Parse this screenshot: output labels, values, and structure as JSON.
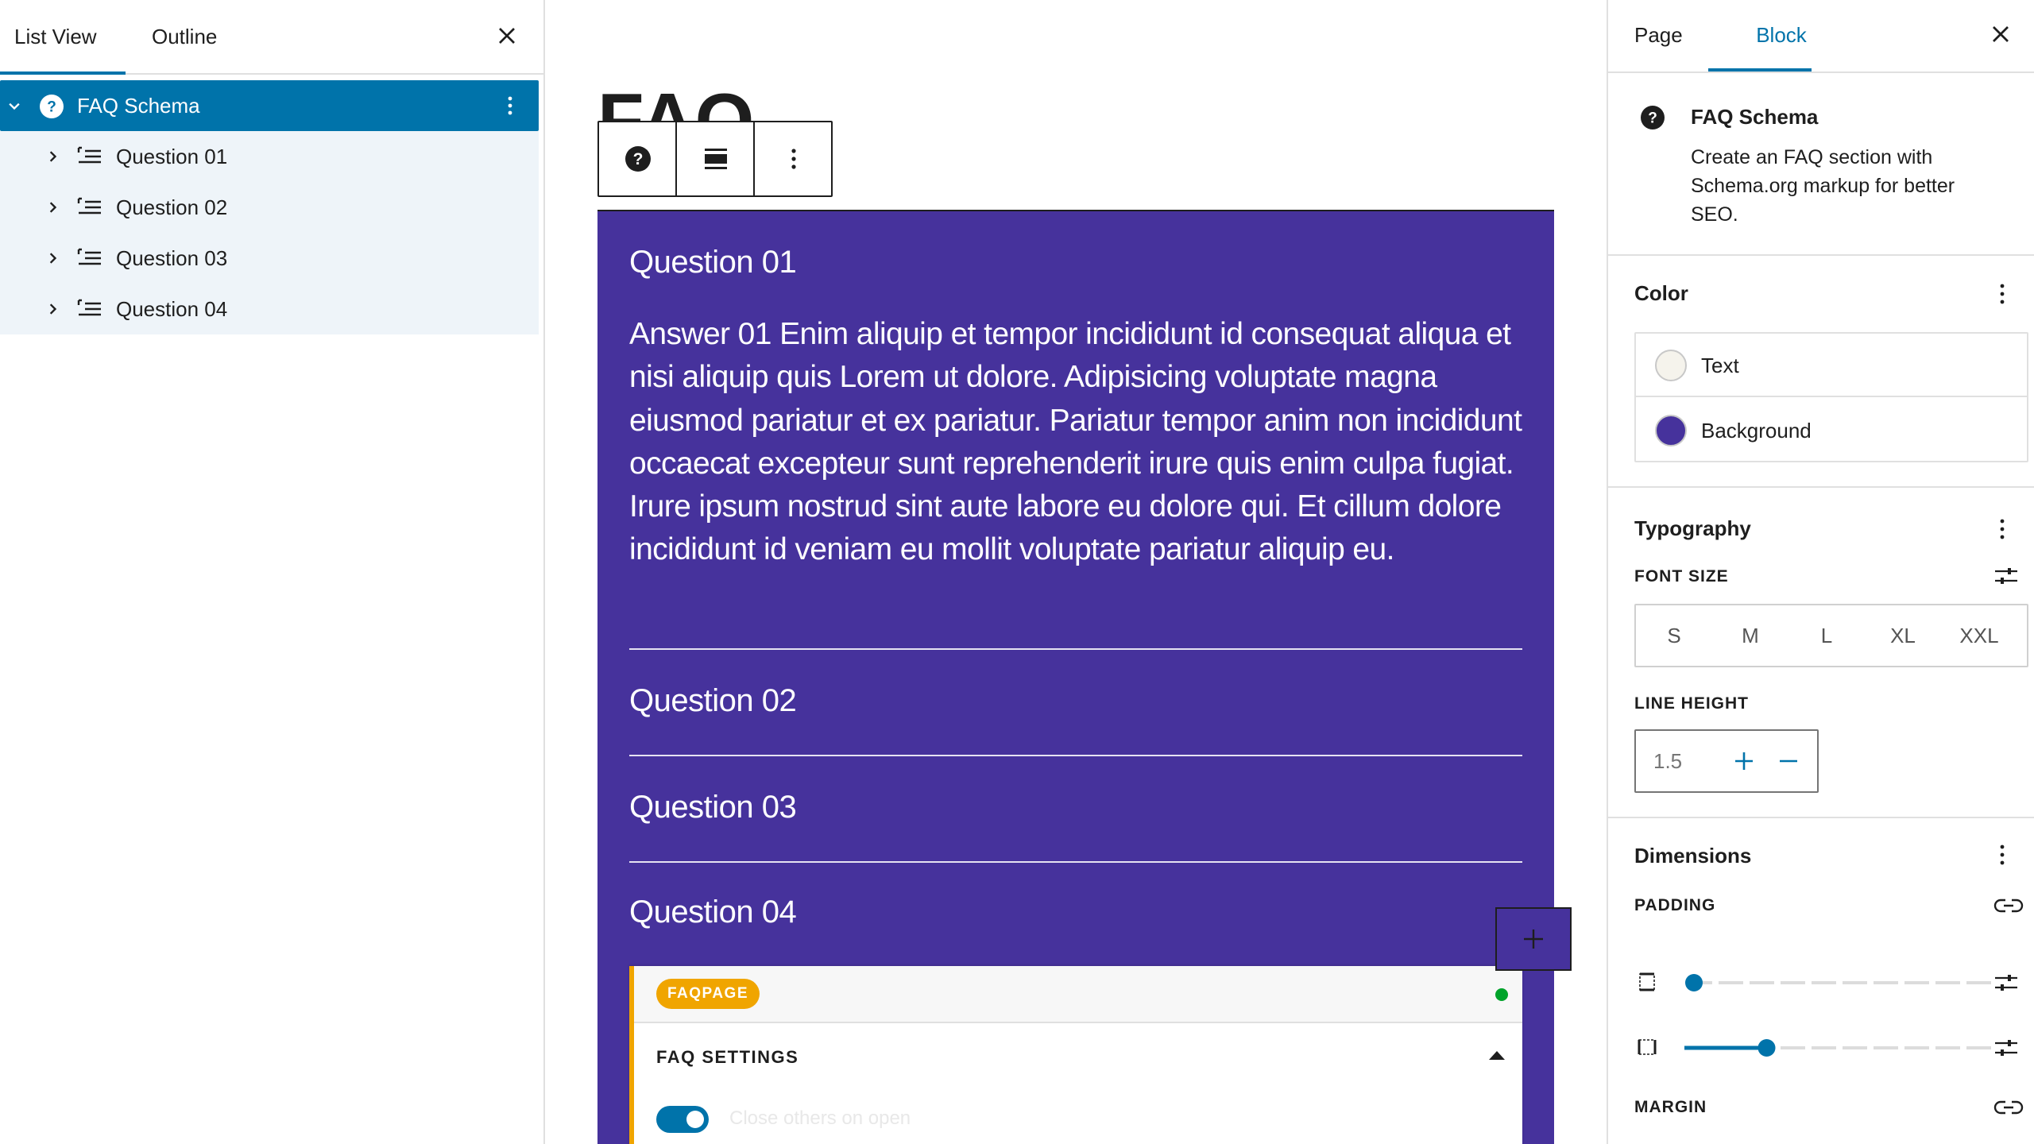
{
  "left_panel": {
    "tabs": [
      "List View",
      "Outline"
    ],
    "active_tab": "List View",
    "tree": {
      "root": "FAQ Schema",
      "children": [
        "Question 01",
        "Question 02",
        "Question 03",
        "Question 04"
      ]
    }
  },
  "canvas": {
    "heading": "FAQ",
    "faq": {
      "items": [
        {
          "question": "Question 01",
          "answer": "Answer 01 Enim aliquip et tempor incididunt id consequat aliqua et nisi aliquip quis Lorem ut dolore. Adipisicing voluptate magna eiusmod pariatur et ex pariatur. Pariatur tempor anim non incididunt occaecat excepteur sunt reprehenderit irure quis enim culpa fugiat. Irure ipsum nostrud sint aute labore eu dolore qui. Et cillum dolore incididunt id veniam eu mollit voluptate pariatur aliquip eu."
        },
        {
          "question": "Question 02"
        },
        {
          "question": "Question 03"
        },
        {
          "question": "Question 04"
        }
      ],
      "background_color": "#46329c",
      "text_color": "#ffffff"
    },
    "schema_panel": {
      "badge": "FAQPAGE",
      "status": "active",
      "settings_title": "FAQ SETTINGS",
      "toggle_label": "Close others on open",
      "toggle_on": true
    }
  },
  "right_panel": {
    "tabs": [
      "Page",
      "Block"
    ],
    "active_tab": "Block",
    "block": {
      "title": "FAQ Schema",
      "description": "Create an FAQ section with Schema.org markup for better SEO."
    },
    "color": {
      "title": "Color",
      "items": [
        {
          "label": "Text",
          "swatch": "#f5f3ec"
        },
        {
          "label": "Background",
          "swatch": "#46329c"
        }
      ]
    },
    "typography": {
      "title": "Typography",
      "font_size_label": "FONT SIZE",
      "font_sizes": [
        "S",
        "M",
        "L",
        "XL",
        "XXL"
      ],
      "line_height_label": "LINE HEIGHT",
      "line_height_placeholder": "1.5"
    },
    "dimensions": {
      "title": "Dimensions",
      "padding_label": "PADDING",
      "padding_vertical_level": 0,
      "padding_horizontal_level": 0.25,
      "margin_label": "MARGIN"
    }
  },
  "accent_color": "#0073aa"
}
